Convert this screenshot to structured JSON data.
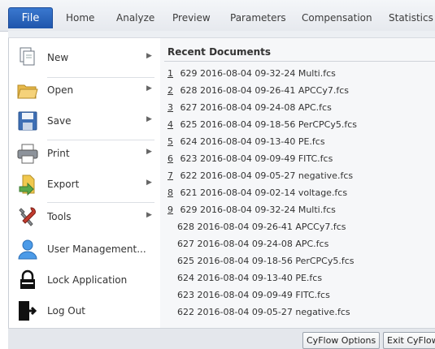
{
  "ribbon": {
    "file_label": "File",
    "tabs": [
      "Home",
      "Analyze",
      "Preview",
      "Parameters",
      "Compensation",
      "Statistics"
    ]
  },
  "menu": {
    "items": [
      {
        "label": "New",
        "icon": "new-document-icon",
        "submenu": true
      },
      {
        "label": "Open",
        "icon": "folder-open-icon",
        "submenu": true
      },
      {
        "label": "Save",
        "icon": "floppy-disk-icon",
        "submenu": true
      },
      {
        "label": "Print",
        "icon": "printer-icon",
        "submenu": true
      },
      {
        "label": "Export",
        "icon": "export-icon",
        "submenu": true
      },
      {
        "label": "Tools",
        "icon": "tools-icon",
        "submenu": true
      },
      {
        "label": "User Management...",
        "icon": "user-icon",
        "submenu": false
      },
      {
        "label": "Lock Application",
        "icon": "lock-icon",
        "submenu": false
      },
      {
        "label": "Log Out",
        "icon": "logout-icon",
        "submenu": false
      }
    ]
  },
  "recent": {
    "title": "Recent Documents",
    "numbered": [
      {
        "n": "1",
        "text": " 629 2016-08-04 09-32-24 Multi.fcs"
      },
      {
        "n": "2",
        "text": " 628 2016-08-04 09-26-41 APCCy7.fcs"
      },
      {
        "n": "3",
        "text": " 627 2016-08-04 09-24-08 APC.fcs"
      },
      {
        "n": "4",
        "text": " 625 2016-08-04 09-18-56 PerCPCy5.fcs"
      },
      {
        "n": "5",
        "text": " 624 2016-08-04 09-13-40 PE.fcs"
      },
      {
        "n": "6",
        "text": " 623 2016-08-04 09-09-49 FITC.fcs"
      },
      {
        "n": "7",
        "text": " 622 2016-08-04 09-05-27 negative.fcs"
      },
      {
        "n": "8",
        "text": " 621 2016-08-04 09-02-14 voltage.fcs"
      },
      {
        "n": "9",
        "text": " 629 2016-08-04 09-32-24 Multi.fcs"
      }
    ],
    "unnumbered": [
      "628 2016-08-04 09-26-41 APCCy7.fcs",
      "627 2016-08-04 09-24-08 APC.fcs",
      "625 2016-08-04 09-18-56 PerCPCy5.fcs",
      "624 2016-08-04 09-13-40 PE.fcs",
      "623 2016-08-04 09-09-49 FITC.fcs",
      "622 2016-08-04 09-05-27 negative.fcs"
    ]
  },
  "footer": {
    "options_label": "CyFlow Options",
    "exit_label": "Exit CyFlow"
  },
  "colors": {
    "file_tab": "#2a63bd",
    "menu_bg": "#ffffff",
    "panel_bg": "#f6f7f9"
  }
}
